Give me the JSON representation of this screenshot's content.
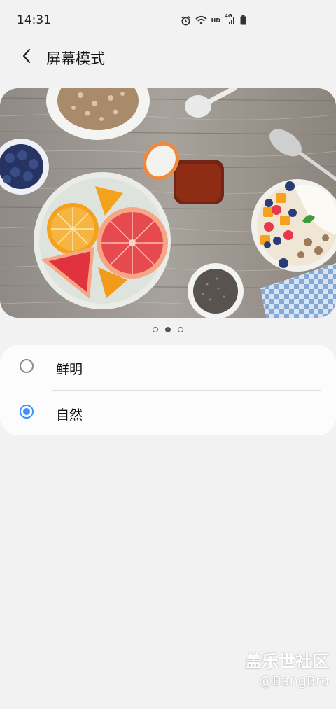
{
  "status_bar": {
    "time": "14:31",
    "hd_label": "HD",
    "network_label": "4G",
    "icons": [
      "alarm-icon",
      "wifi-icon",
      "hd-icon",
      "signal-icon",
      "battery-icon"
    ]
  },
  "header": {
    "title": "屏幕模式",
    "back_icon": "chevron-left-icon"
  },
  "preview": {
    "image": "food-table-preview",
    "page_count": 3,
    "active_page": 2
  },
  "options": [
    {
      "label": "鲜明",
      "checked": false
    },
    {
      "label": "自然",
      "checked": true
    }
  ],
  "watermark": {
    "brand": "盖乐世社区",
    "user": "@BangBro"
  },
  "colors": {
    "accent": "#3e91ff",
    "background": "#f2f2f2",
    "card": "#fcfcfc"
  }
}
